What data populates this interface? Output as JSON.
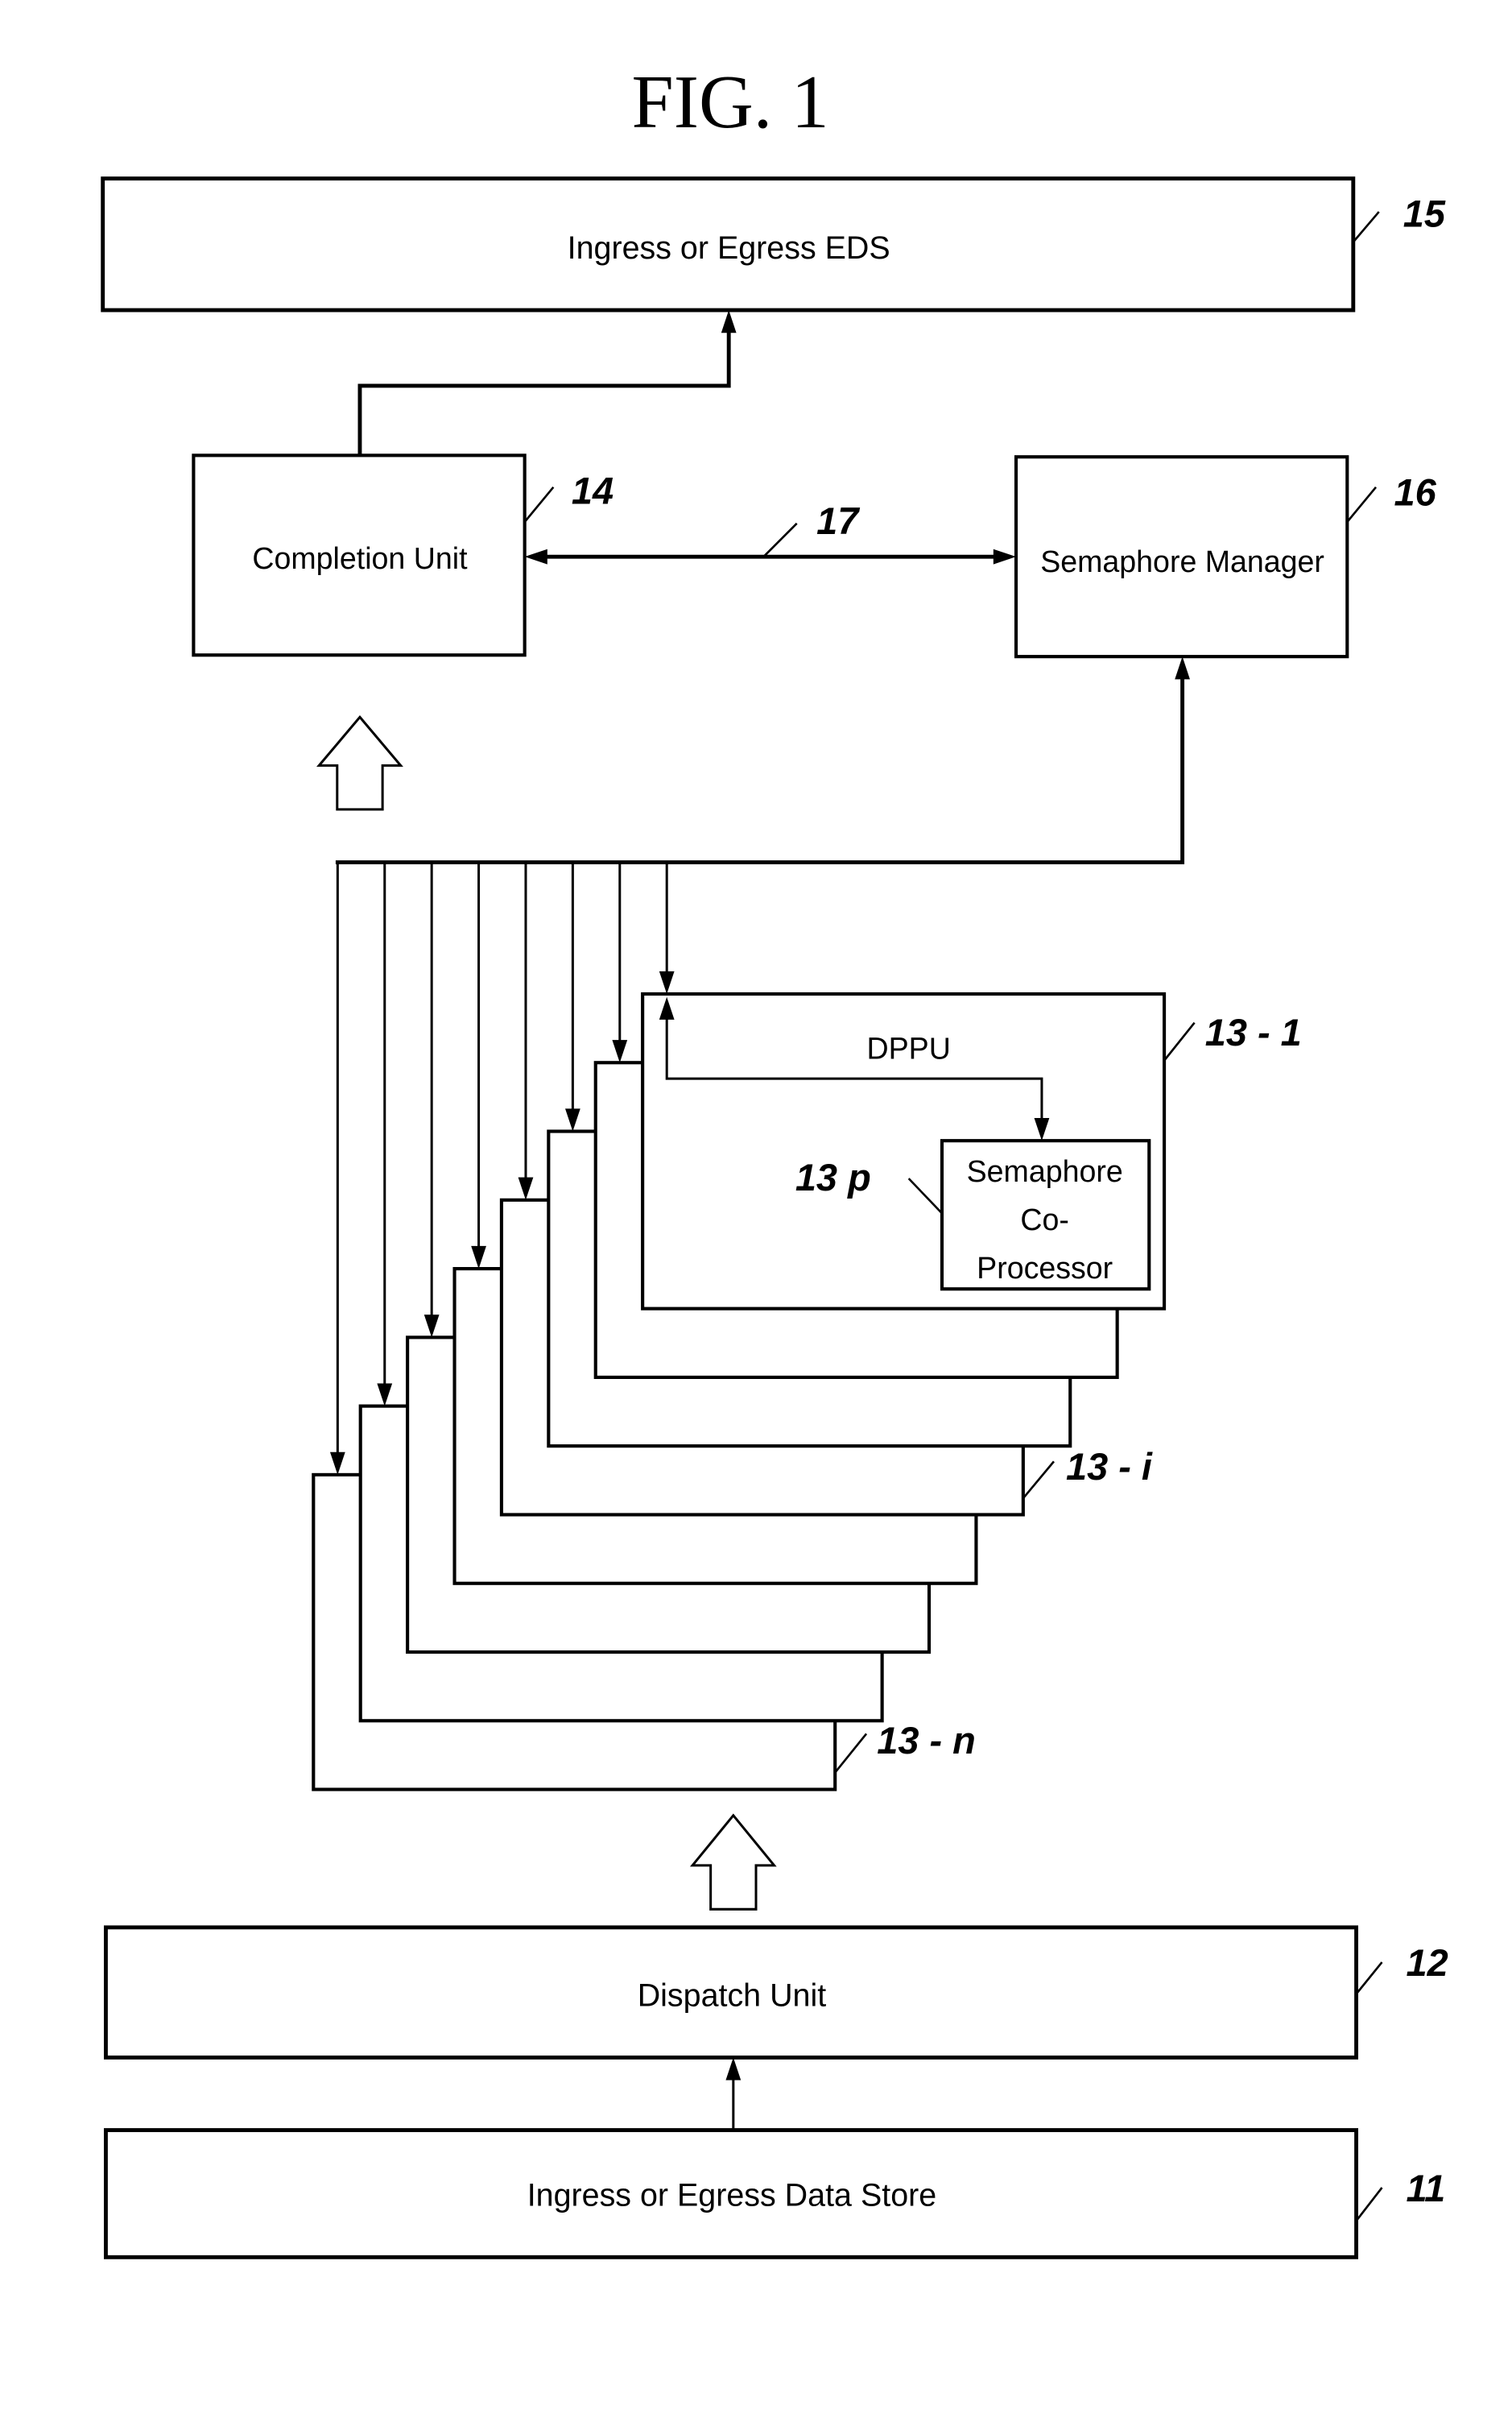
{
  "figure": {
    "title": "FIG. 1"
  },
  "blocks": {
    "eds": {
      "label": "Ingress or Egress EDS",
      "ref": "15"
    },
    "completion_unit": {
      "label": "Completion Unit",
      "ref": "14"
    },
    "semaphore_manager": {
      "label": "Semaphore Manager",
      "ref": "16"
    },
    "link": {
      "ref": "17"
    },
    "dppu": {
      "label": "DPPU",
      "ref_first": "13 - 1",
      "ref_middle": "13 - i",
      "ref_last": "13 - n",
      "stack_count": 8
    },
    "coprocessor": {
      "lines": [
        "Semaphore",
        "Co-",
        "Processor"
      ],
      "ref": "13 p"
    },
    "dispatch_unit": {
      "label": "Dispatch Unit",
      "ref": "12"
    },
    "data_store": {
      "label": "Ingress or Egress Data Store",
      "ref": "11"
    }
  }
}
